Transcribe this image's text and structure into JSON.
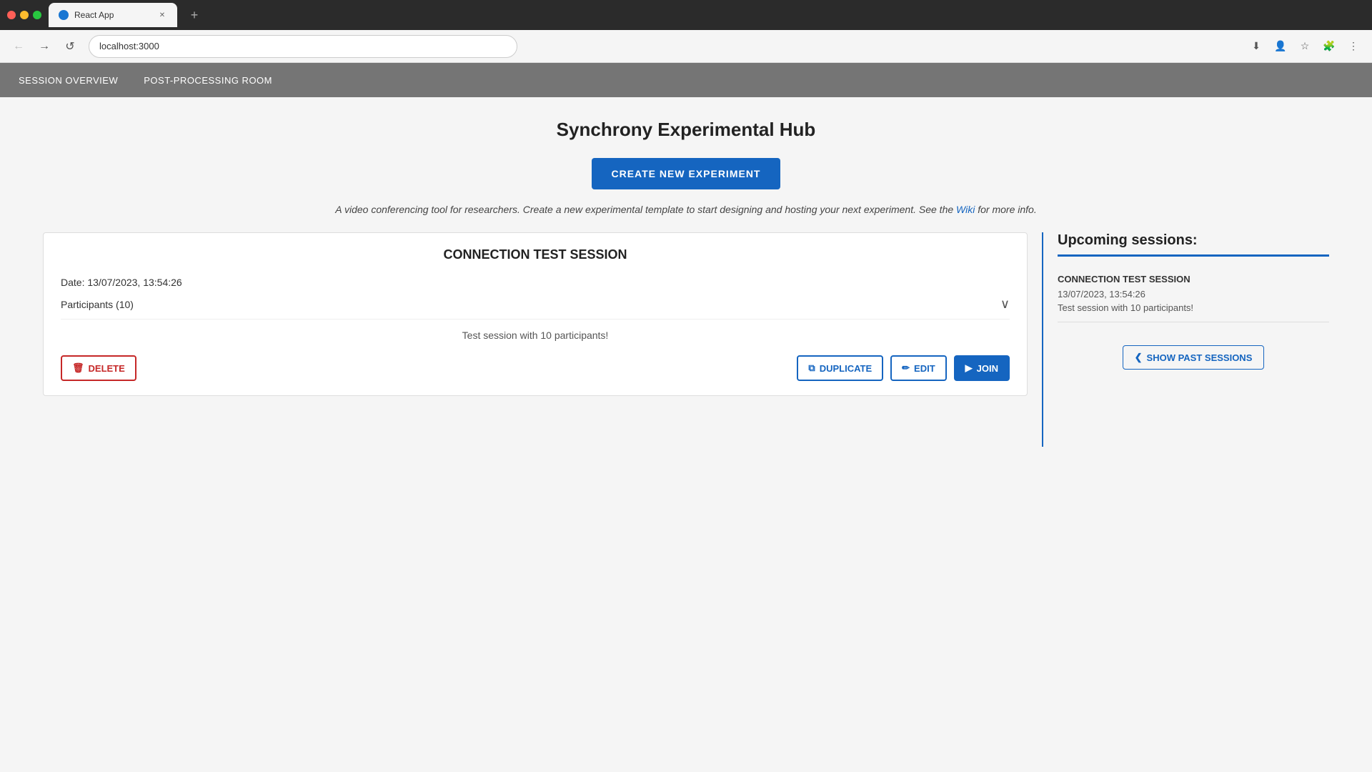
{
  "browser": {
    "tab_title": "React App",
    "url": "localhost:3000",
    "back_btn": "←",
    "forward_btn": "→",
    "reload_btn": "↺"
  },
  "nav": {
    "items": [
      {
        "id": "session-overview",
        "label": "SESSION OVERVIEW"
      },
      {
        "id": "post-processing-room",
        "label": "POST-PROCESSING ROOM"
      }
    ]
  },
  "main": {
    "page_title": "Synchrony Experimental Hub",
    "create_btn_label": "CREATE NEW EXPERIMENT",
    "description_text": "A video conferencing tool for researchers. Create a new experimental template to start designing and hosting your next experiment. See the ",
    "wiki_link_text": "Wiki",
    "description_suffix": " for more info.",
    "sessions": [
      {
        "title": "CONNECTION TEST SESSION",
        "date_label": "Date:",
        "date_value": "13/07/2023, 13:54:26",
        "participants_label": "Participants (10)",
        "description": "Test session with 10 participants!",
        "delete_label": "DELETE",
        "duplicate_label": "DUPLICATE",
        "edit_label": "EDIT",
        "join_label": "JOIN"
      }
    ]
  },
  "upcoming": {
    "title": "Upcoming sessions:",
    "sessions": [
      {
        "name": "CONNECTION TEST SESSION",
        "date": "13/07/2023, 13:54:26",
        "description": "Test session with 10 participants!"
      }
    ],
    "show_past_label": "SHOW PAST SESSIONS"
  },
  "icons": {
    "trash": "🗑",
    "copy": "⧉",
    "edit": "✏",
    "play": "▶",
    "chevron_down": "∨",
    "chevron_left": "❮"
  }
}
